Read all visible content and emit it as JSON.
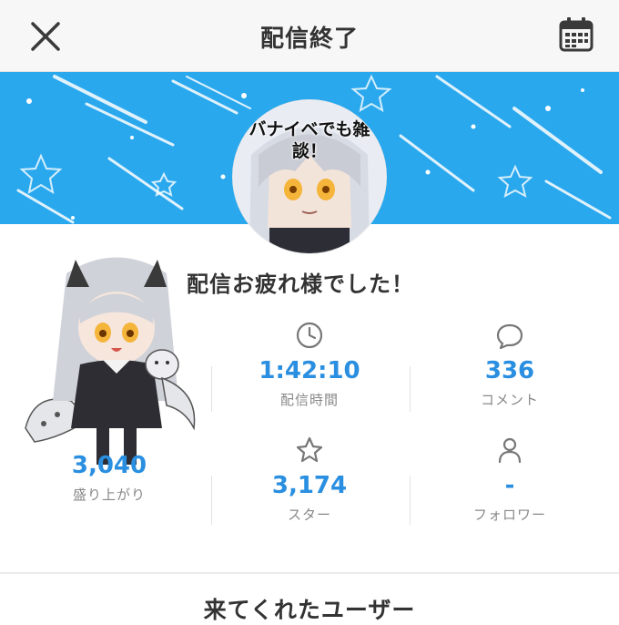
{
  "header": {
    "title": "配信終了",
    "close_icon": "close-icon",
    "calendar_icon": "calendar-icon"
  },
  "stream": {
    "thumbnail_text": "バナイベでも雑談！"
  },
  "greeting": "配信お疲れ様でした！",
  "stats": [
    {
      "icon": "clock-icon",
      "value": "1:42:10",
      "label": "配信時間"
    },
    {
      "icon": "comment-icon",
      "value": "336",
      "label": "コメント"
    },
    {
      "icon": null,
      "value": "3,040",
      "label": "盛り上がり"
    },
    {
      "icon": "star-icon",
      "value": "3,174",
      "label": "スター"
    },
    {
      "icon": "person-icon",
      "value": "-",
      "label": "フォロワー"
    }
  ],
  "section": {
    "title": "来てくれたユーザー"
  },
  "colors": {
    "accent": "#2a8fe0",
    "banner": "#2aa8ee"
  }
}
